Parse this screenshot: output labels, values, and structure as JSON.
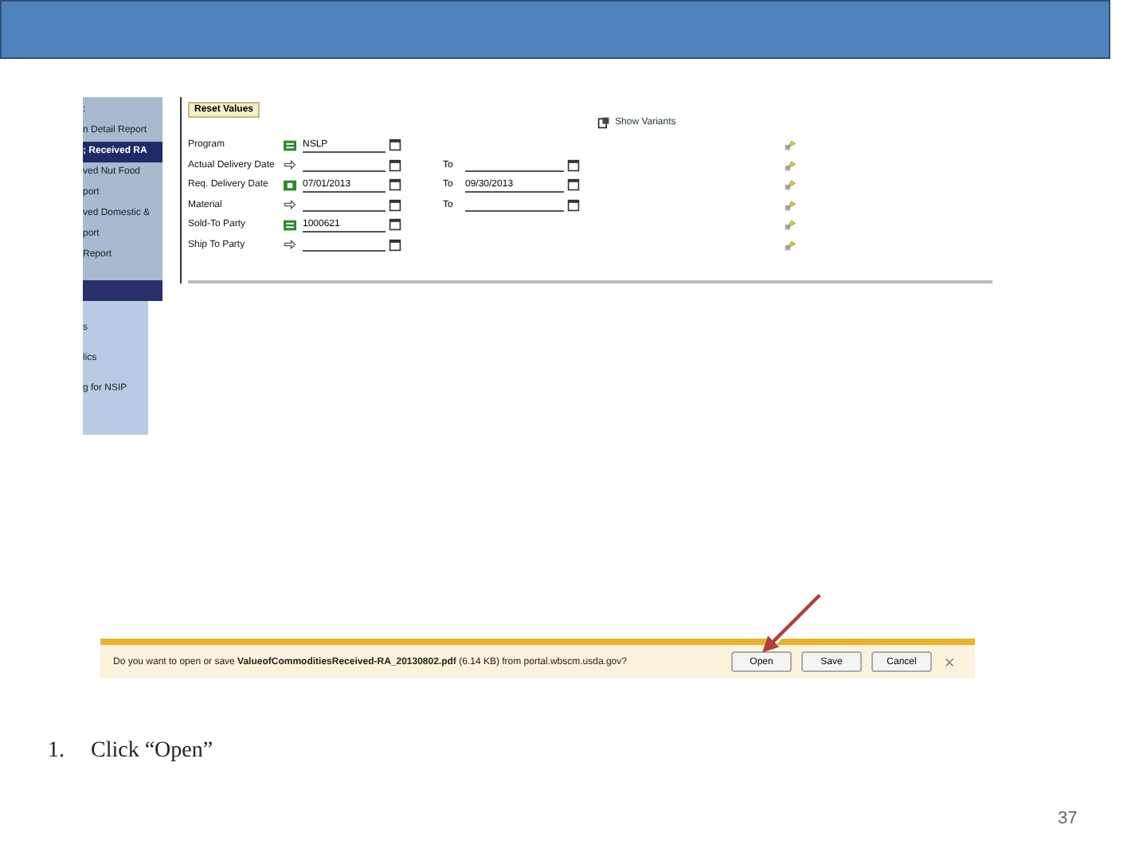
{
  "sidebar": {
    "items": [
      {
        "label": ":",
        "selected": false
      },
      {
        "label": "n Detail Report",
        "selected": false
      },
      {
        "label": "; Received   RA",
        "selected": true
      },
      {
        "label": "ved   Nut Food",
        "selected": false
      },
      {
        "label": "port",
        "selected": false
      },
      {
        "label": "ved   Domestic &",
        "selected": false
      },
      {
        "label": "port",
        "selected": false
      },
      {
        "label": "Report",
        "selected": false
      }
    ],
    "lower_items": [
      "s",
      "lics",
      "g for NSIP"
    ]
  },
  "form": {
    "reset_button": "Reset Values",
    "show_variants": "Show Variants",
    "rows": [
      {
        "label": "Program",
        "kind": "equals",
        "value": "NSLP"
      },
      {
        "label": "Actual Delivery Date",
        "kind": "arrow",
        "to_label": "To"
      },
      {
        "label": "Req. Delivery Date",
        "kind": "between",
        "value": "07/01/2013",
        "to_label": "To",
        "to_value": "09/30/2013"
      },
      {
        "label": "Material",
        "kind": "arrow",
        "to_label": "To"
      },
      {
        "label": "Sold-To Party",
        "kind": "equals",
        "value": "1000621"
      },
      {
        "label": "Ship To Party",
        "kind": "arrow"
      }
    ]
  },
  "download_bar": {
    "prompt_start": "Do you want to open or save ",
    "file_name": "ValueofCommoditiesReceived-RA_20130802.pdf",
    "prompt_end": " (6.14 KB) from portal.wbscm.usda.gov?",
    "buttons": [
      "Open",
      "Save",
      "Cancel"
    ]
  },
  "step": {
    "number": "1.",
    "text": "Click “Open”"
  },
  "page_number": "37"
}
